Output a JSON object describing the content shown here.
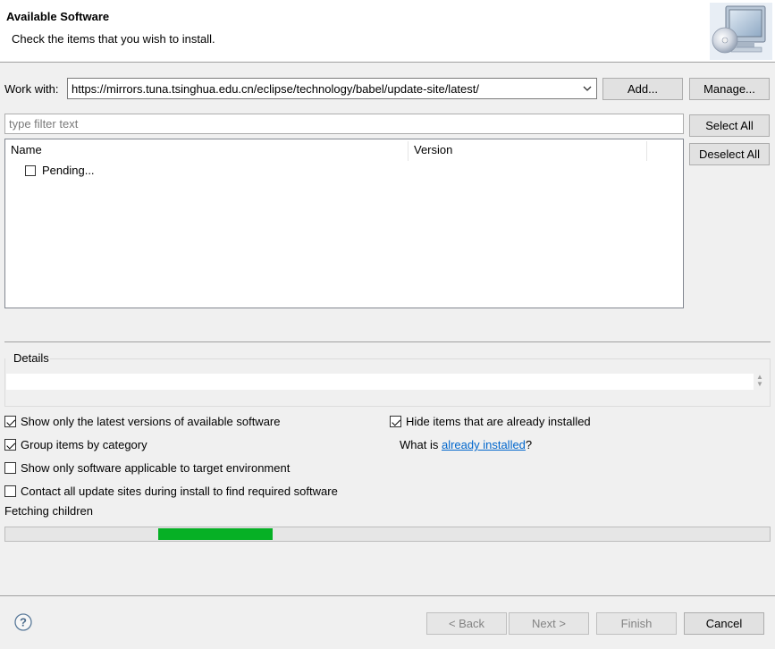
{
  "header": {
    "title": "Available Software",
    "subtitle": "Check the items that you wish to install.",
    "banner_icon": "monitor-cd-icon"
  },
  "work_with": {
    "label": "Work with:",
    "value": "https://mirrors.tuna.tsinghua.edu.cn/eclipse/technology/babel/update-site/latest/",
    "add_label": "Add...",
    "manage_label": "Manage..."
  },
  "filter": {
    "placeholder": "type filter text",
    "value": ""
  },
  "buttons": {
    "select_all": "Select All",
    "deselect_all": "Deselect All"
  },
  "tree": {
    "columns": [
      "Name",
      "Version"
    ],
    "items": [
      {
        "label": "Pending...",
        "checked": false
      }
    ]
  },
  "details": {
    "label": "Details",
    "text": ""
  },
  "options": {
    "latest_versions": {
      "label": "Show only the latest versions of available software",
      "checked": true
    },
    "group_by_category": {
      "label": "Group items by category",
      "checked": true
    },
    "applicable_target": {
      "label": "Show only software applicable to target environment",
      "checked": false
    },
    "contact_all_sites": {
      "label": "Contact all update sites during install to find required software",
      "checked": false
    },
    "hide_installed": {
      "label": "Hide items that are already installed",
      "checked": true
    },
    "what_is_prefix": "What is ",
    "what_is_link": "already installed",
    "what_is_suffix": "?"
  },
  "status": {
    "text": "Fetching children",
    "progress_start_fraction": 0.2,
    "progress_end_fraction": 0.35,
    "progress_color": "#06b025"
  },
  "footer": {
    "help_icon": "help-icon",
    "back_label": "< Back",
    "next_label": "Next >",
    "finish_label": "Finish",
    "cancel_label": "Cancel"
  }
}
